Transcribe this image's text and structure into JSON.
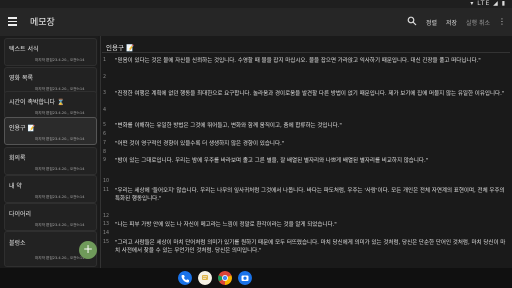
{
  "status": {
    "time": "",
    "right": "▾ LTE ◢ ▮"
  },
  "appbar": {
    "title": "메모장",
    "actions": [
      "정렬",
      "저장",
      "실행 취소"
    ],
    "more": "⋮"
  },
  "notes": [
    {
      "title": "텍스트 서식",
      "date": "마지막 편집23.4.20., 오전9:14"
    },
    {
      "title": "영화 목록",
      "date": "마지막 편집23.4.20., 오전9:14"
    },
    {
      "title": "시간이 촉박합니다 ⌛",
      "date": "마지막 편집23.4.20., 오전9:14"
    },
    {
      "title": "인용구 📝",
      "date": "마지막 편집23.4.20., 오전9:14"
    },
    {
      "title": "회의록",
      "date": "마지막 편집23.4.20., 오전9:14"
    },
    {
      "title": "내 약",
      "date": "마지막 편집23.4.20., 오전9:14"
    },
    {
      "title": "다이어리",
      "date": "마지막 편집23.4.20., 오전9:14"
    },
    {
      "title": "블렁소",
      "date": "마지막 편집23.4.20., 오전9:14"
    }
  ],
  "editor": {
    "title": "인용구 📝",
    "lines": [
      {
        "n": "1",
        "t": "\"믿음이 있다는 것은 물에 자신을 신뢰하는 것입니다. 수영할 때 물을 잡지 마십시오. 물을 잡으면 가라앉고 익사하기 때문입니다. 대신 긴장을 풀고 떠다닙니다.\""
      },
      {
        "n": "2",
        "t": ""
      },
      {
        "n": "3",
        "t": "\"진정한 여행은 계획에 없던 행동을 최대한으로 요구합니다. 놀라움과 경이로움을 발견할 다른 방법이 없기 때문입니다. 제가 보기에 집에 머물지 않는 유일한 이유입니다.\""
      },
      {
        "n": "4",
        "t": ""
      },
      {
        "n": "5",
        "t": "\"변화를 이해하는 유일한 방법은 그것에 뛰어들고, 변화와 함께 움직이고, 춤에 합류하는 것입니다.\""
      },
      {
        "n": "6",
        "t": ""
      },
      {
        "n": "7",
        "t": "\"어떤 것이 영구적인 경향이 있을수록 더 생생하지 않은 경향이 있습니다.\""
      },
      {
        "n": "8",
        "t": ""
      },
      {
        "n": "9",
        "t": "\"밤이 있는 그대로입니다. 우리는 밤에 우주를 바라보며 졸고 그른 별을, 잘 배열된 별자리와 나쁘게 배열된 별자리를 비교하지 않습니다.\""
      },
      {
        "n": "10",
        "t": ""
      },
      {
        "n": "11",
        "t": "\"우리는 세상에 '들어오지' 않습니다. 우리는 나무의 잎사귀처럼 그것에서 나옵니다. 바다는 파도처럼, 우주는 '사람'이다. 모든 개인은 전체 자연계의 표현이며, 전체 우주의 특화된 행동입니다.\""
      },
      {
        "n": "12",
        "t": ""
      },
      {
        "n": "13",
        "t": "\"나는 피부 가방 안에 있는 나 자신이 메고라는 느낌이 정말로 환각이라는 것을 알게 되었습니다.\""
      },
      {
        "n": "14",
        "t": ""
      },
      {
        "n": "15",
        "t": "\"그리고 사람들은 세상이 마치 단어처럼 의미가 있기를 원하기 때문에 모두 터뜨렸습니다. 마치 당신에게 의미가 있는 것처럼, 당신은 단순한 단어인 것처럼, 마치 당신이 마치 사전에서 찾을 수 있는 무언가인 것처럼. 당신은 의미입니다.\""
      }
    ]
  },
  "dock": [
    "phone-app",
    "messages-app",
    "chrome-app",
    "camera-app"
  ],
  "colors": {
    "fab": "#6f9a5a",
    "background": "#1a1a1a"
  }
}
